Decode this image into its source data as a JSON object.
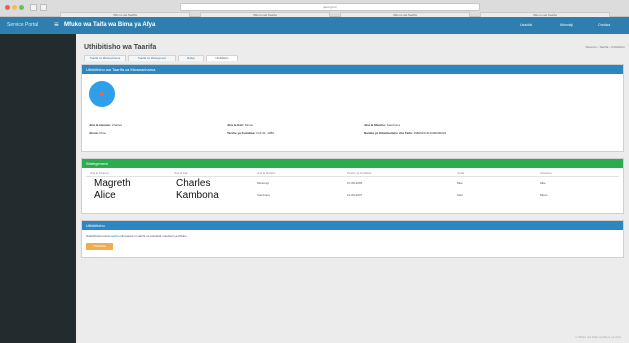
{
  "browser": {
    "address": "jamii.go.tz",
    "tabs": [
      "Mfumo wa Taarifa",
      "Mfumo wa Taarifa",
      "Mfumo wa Taarifa",
      "Mfumo wa Taarifa"
    ]
  },
  "topbar": {
    "brand": "Service Portal",
    "title": "Mfuko wa Taifa wa Bima ya Afya",
    "right_items": [
      "Usaidizi",
      "Mtumiaji",
      "Ondoka"
    ]
  },
  "page": {
    "title": "Uthibitisho wa Taarifa",
    "breadcrumb": "Mwanzo › Taarifa › Uthibitisho",
    "tabs": [
      "Taarifa za Mwanachama",
      "Taarifa za Wategemezi",
      "Malipo",
      "Uthibitisho"
    ]
  },
  "member_panel": {
    "header": "Uthibitisho wa Taarifa za Mwanachama",
    "fields": [
      {
        "label": "Jina la kwanza:",
        "value": "Charles"
      },
      {
        "label": "Jina la Kati:",
        "value": "Simon"
      },
      {
        "label": "Jina la Mwisho:",
        "value": "Kambona"
      },
      {
        "label": "Jinsia:",
        "value": "Mme"
      },
      {
        "label": "Tarehe ya Kuzaliwa:",
        "value": "Feb 21, 1980"
      },
      {
        "label": "Namba ya Kitambulisho cha Taifa:",
        "value": "19800221111000000022"
      }
    ]
  },
  "dependents_panel": {
    "header": "Wategemezi",
    "columns": [
      "Jina la Kwanza",
      "Jina la Kati",
      "Jina la Mwisho",
      "Tarehe ya Kuzaliwa",
      "Jinsia",
      "Uhusiano"
    ],
    "rows": [
      {
        "first": "Magreth",
        "middle": "Charles",
        "last": "Msolongi",
        "dob": "07-08-2005",
        "gender": "Mke",
        "relation": "Mke"
      },
      {
        "first": "Alice",
        "middle": "Kambona",
        "last": "Kambona",
        "dob": "12-09-2007",
        "gender": "Kike",
        "relation": "Mtoto"
      }
    ]
  },
  "confirm_panel": {
    "header": "Uthibitisho",
    "note_start": "Nathibitisha kuwa",
    "note_link": "taarifa",
    "note_end": "nilizoweka ni sahihi na kukubali masharti ya Mfuko.",
    "button": "Thibitisha"
  },
  "footer": "© Mfuko wa Taifa wa Bima ya Afya"
}
